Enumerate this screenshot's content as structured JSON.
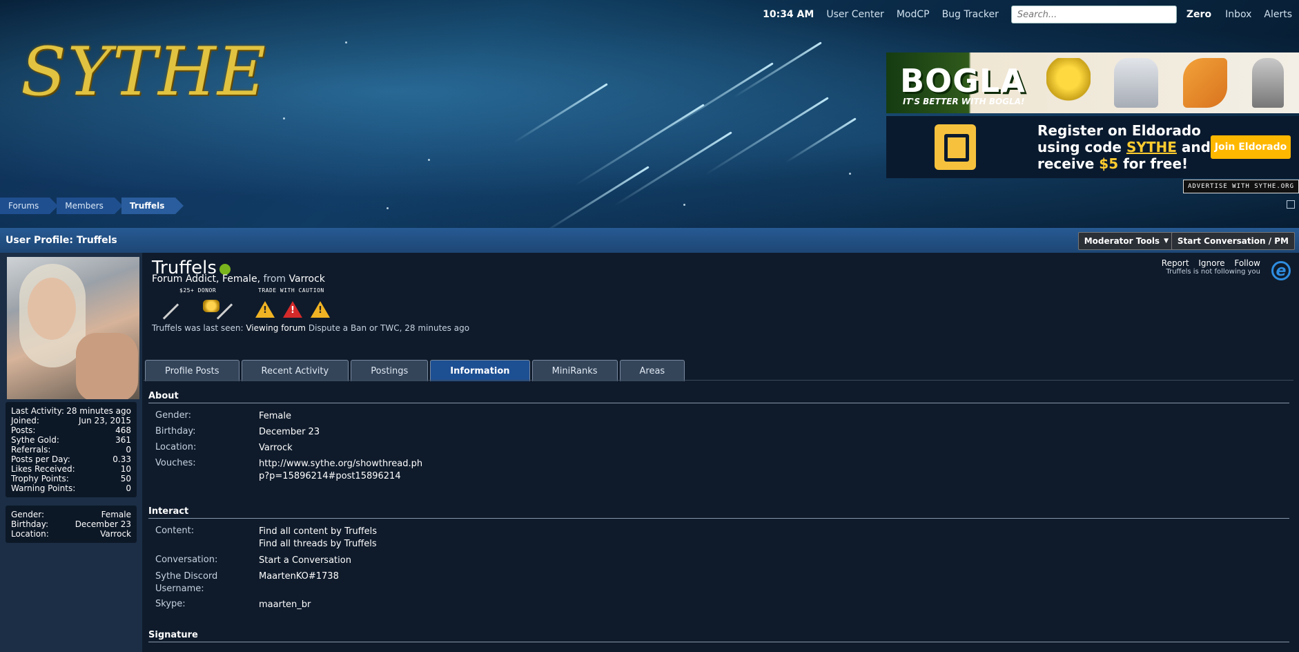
{
  "topnav": {
    "time": "10:34 AM",
    "links": [
      "User Center",
      "ModCP",
      "Bug Tracker"
    ],
    "search_placeholder": "Search...",
    "user": "Zero",
    "inbox": "Inbox",
    "alerts": "Alerts"
  },
  "logo": {
    "text": "SYTHE"
  },
  "ads": {
    "bogla": {
      "brand": "BOGLA",
      "tagline": "IT'S BETTER WITH BOGLA!"
    },
    "eldorado": {
      "line1": "Register on Eldorado",
      "line2_pre": "using code ",
      "line2_code": "SYTHE",
      "line2_post": " and",
      "line3_pre": "receive ",
      "line3_amount": "$5",
      "line3_post": " for free!",
      "button": "Join Eldorado"
    },
    "advertise": "ADVERTISE WITH SYTHE.ORG"
  },
  "breadcrumb": [
    "Forums",
    "Members",
    "Truffels"
  ],
  "titlebar": {
    "title": "User Profile: Truffels",
    "mod_tools": "Moderator Tools",
    "start_conversation": "Start Conversation / PM"
  },
  "sidebar": {
    "stats": [
      {
        "label": "Last Activity:",
        "value": "28 minutes ago"
      },
      {
        "label": "Joined:",
        "value": "Jun 23, 2015"
      },
      {
        "label": "Posts:",
        "value": "468"
      },
      {
        "label": "Sythe Gold:",
        "value": "361"
      },
      {
        "label": "Referrals:",
        "value": "0"
      },
      {
        "label": "Posts per Day:",
        "value": "0.33"
      },
      {
        "label": "Likes Received:",
        "value": "10"
      },
      {
        "label": "Trophy Points:",
        "value": "50"
      },
      {
        "label": "Warning Points:",
        "value": "0"
      }
    ],
    "info": [
      {
        "label": "Gender:",
        "value": "Female"
      },
      {
        "label": "Birthday:",
        "value": "December 23"
      },
      {
        "label": "Location:",
        "value": "Varrock"
      }
    ]
  },
  "profile": {
    "username": "Truffels",
    "title_rank": "Forum Addict",
    "gender": "Female",
    "from_word": "from",
    "location": "Varrock",
    "badge_donor": "$25+ DONOR",
    "badge_twc": "TRADE WITH CAUTION",
    "last_seen_pre": "Truffels was last seen:",
    "last_seen_action": "Viewing forum",
    "last_seen_forum": "Dispute a Ban or TWC",
    "last_seen_time": "28 minutes ago",
    "report": "Report",
    "ignore": "Ignore",
    "follow": "Follow",
    "not_following": "Truffels is not following you"
  },
  "tabs": [
    "Profile Posts",
    "Recent Activity",
    "Postings",
    "Information",
    "MiniRanks",
    "Areas"
  ],
  "active_tab": "Information",
  "about": {
    "title": "About",
    "rows": [
      {
        "label": "Gender:",
        "value": "Female"
      },
      {
        "label": "Birthday:",
        "value": "December 23"
      },
      {
        "label": "Location:",
        "value": "Varrock"
      },
      {
        "label": "Vouches:",
        "value": "http://www.sythe.org/showthread.php?p=15896214#post15896214"
      }
    ]
  },
  "interact": {
    "title": "Interact",
    "content_label": "Content:",
    "content_links": [
      "Find all content by Truffels",
      "Find all threads by Truffels"
    ],
    "conversation_label": "Conversation:",
    "conversation_value": "Start a Conversation",
    "discord_label": "Sythe Discord Username:",
    "discord_value": "MaartenKO#1738",
    "skype_label": "Skype:",
    "skype_value": "maarten_br"
  },
  "signature": {
    "title": "Signature"
  }
}
